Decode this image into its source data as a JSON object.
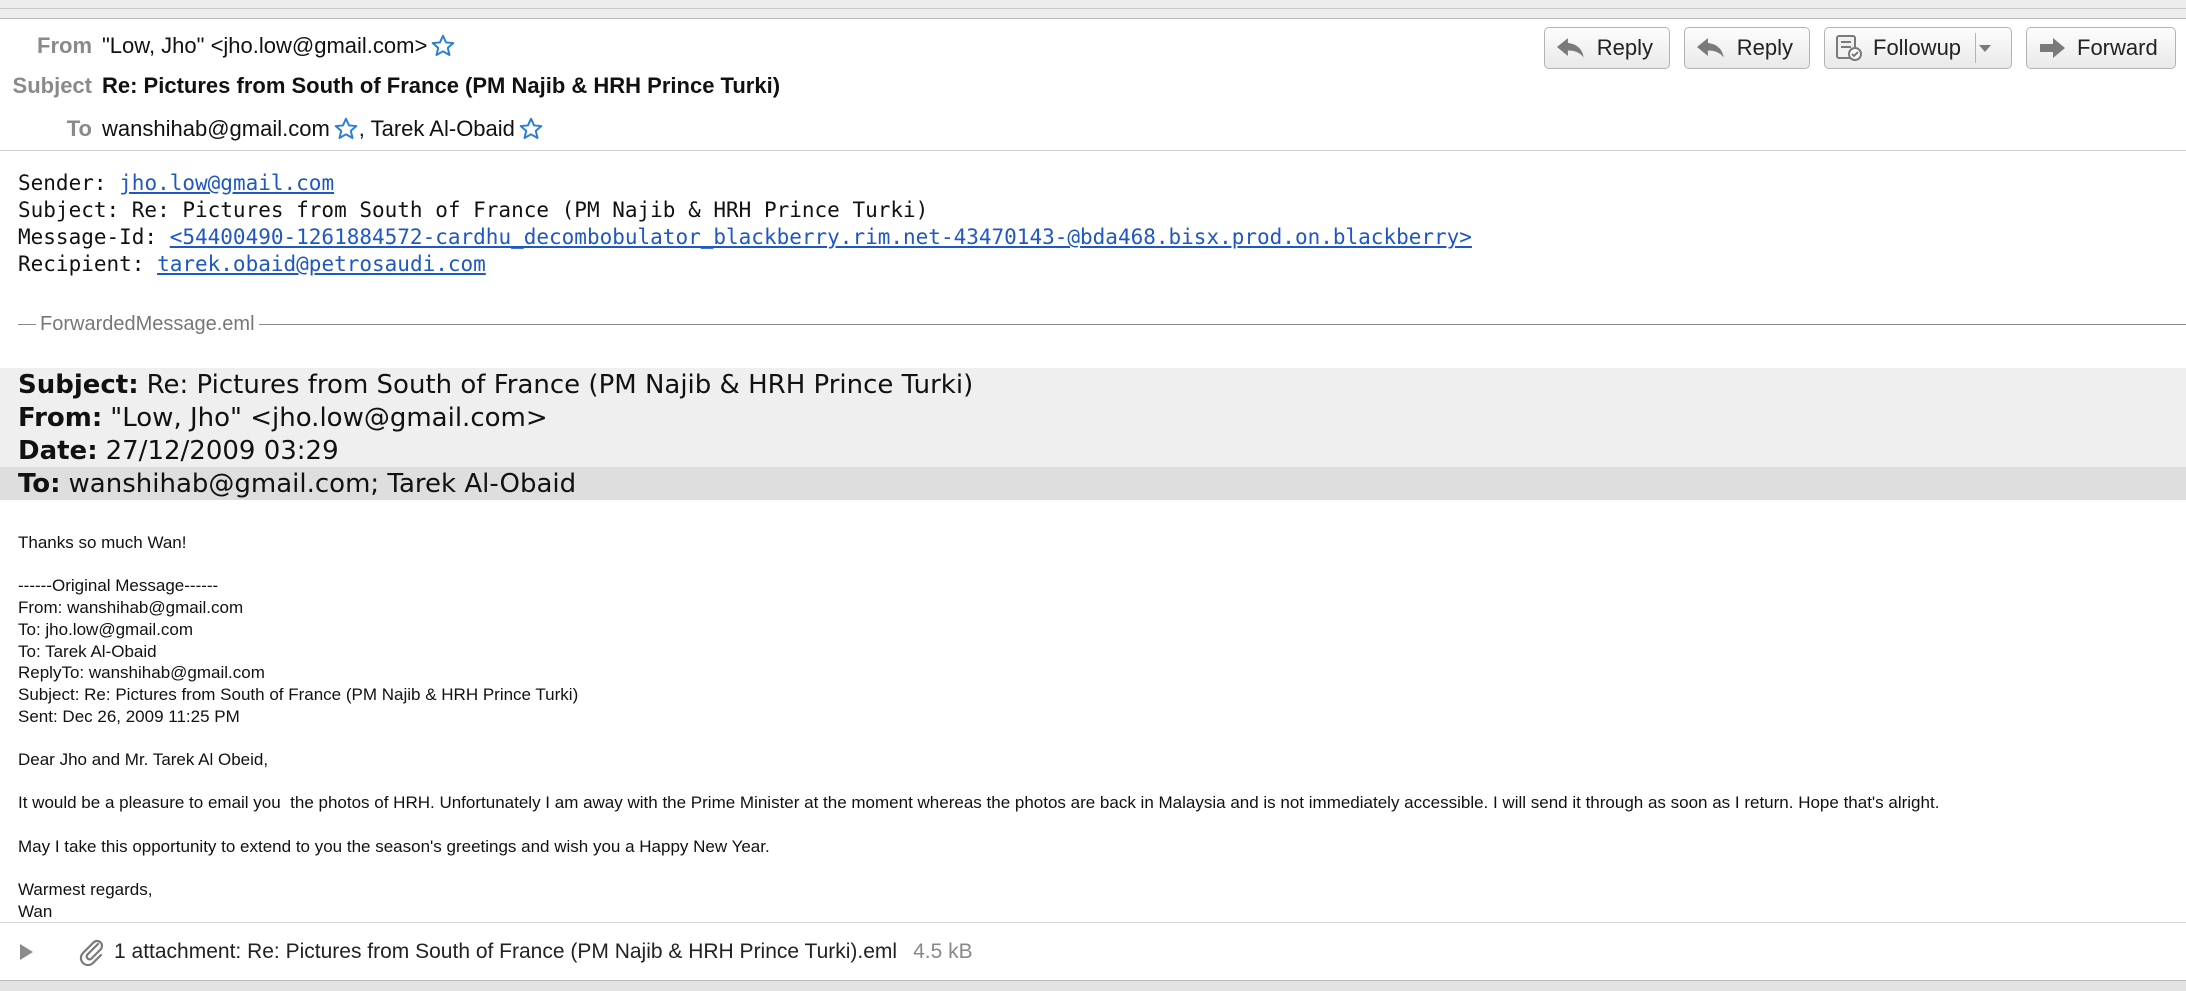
{
  "header": {
    "from_label": "From",
    "from_value": "\"Low, Jho\" <jho.low@gmail.com>",
    "subject_label": "Subject",
    "subject_value": "Re: Pictures from South of France (PM Najib & HRH Prince Turki)",
    "to_label": "To",
    "to_first": "wanshihab@gmail.com",
    "to_second": ", Tarek Al-Obaid"
  },
  "toolbar": {
    "reply_label": "Reply",
    "reply_all_label": "Reply",
    "followup_label": "Followup",
    "forward_label": "Forward"
  },
  "meta": {
    "sender_label": "Sender: ",
    "sender_value": "jho.low@gmail.com",
    "subject_line": "Subject: Re: Pictures from South of France (PM Najib & HRH Prince Turki)",
    "message_id_label": "Message-Id: ",
    "message_id_value": "<54400490-1261884572-cardhu_decombobulator_blackberry.rim.net-43470143-@bda468.bisx.prod.on.blackberry>",
    "recipient_label": "Recipient: ",
    "recipient_value": "tarek.obaid@petrosaudi.com"
  },
  "forwarded": {
    "section_label": "ForwardedMessage.eml",
    "subject_key": "Subject:",
    "subject_value": "Re: Pictures from South of France (PM Najib & HRH Prince Turki)",
    "from_key": "From:",
    "from_value": "\"Low, Jho\" <jho.low@gmail.com>",
    "date_key": "Date:",
    "date_value": "27/12/2009 03:29",
    "to_key": "To:",
    "to_value": "wanshihab@gmail.com; Tarek Al-Obaid"
  },
  "body_text": "Thanks so much Wan!\n\n------Original Message------\nFrom: wanshihab@gmail.com\nTo: jho.low@gmail.com\nTo: Tarek Al-Obaid\nReplyTo: wanshihab@gmail.com\nSubject: Re: Pictures from South of France (PM Najib & HRH Prince Turki)\nSent: Dec 26, 2009 11:25 PM\n\nDear Jho and Mr. Tarek Al Obeid,\n\nIt would be a pleasure to email you  the photos of HRH. Unfortunately I am away with the Prime Minister at the moment whereas the photos are back in Malaysia and is not immediately accessible. I will send it through as soon as I return. Hope that's alright.\n\nMay I take this opportunity to extend to you the season's greetings and wish you a Happy New Year.\n\nWarmest regards,\nWan",
  "attachment": {
    "label": "1 attachment: Re: Pictures from South of France (PM Najib & HRH Prince Turki).eml",
    "size": "4.5 kB"
  },
  "icons": {
    "star": "star-icon",
    "reply": "reply-arrow-icon",
    "followup": "followup-icon",
    "forward": "forward-arrow-icon",
    "paperclip": "paperclip-icon",
    "expand": "disclosure-triangle-icon"
  },
  "colors": {
    "link": "#1f57c3",
    "star": "#2a7fd4",
    "forwarded_header_bg": "#efefef",
    "forwarded_to_bg": "#dedede"
  }
}
